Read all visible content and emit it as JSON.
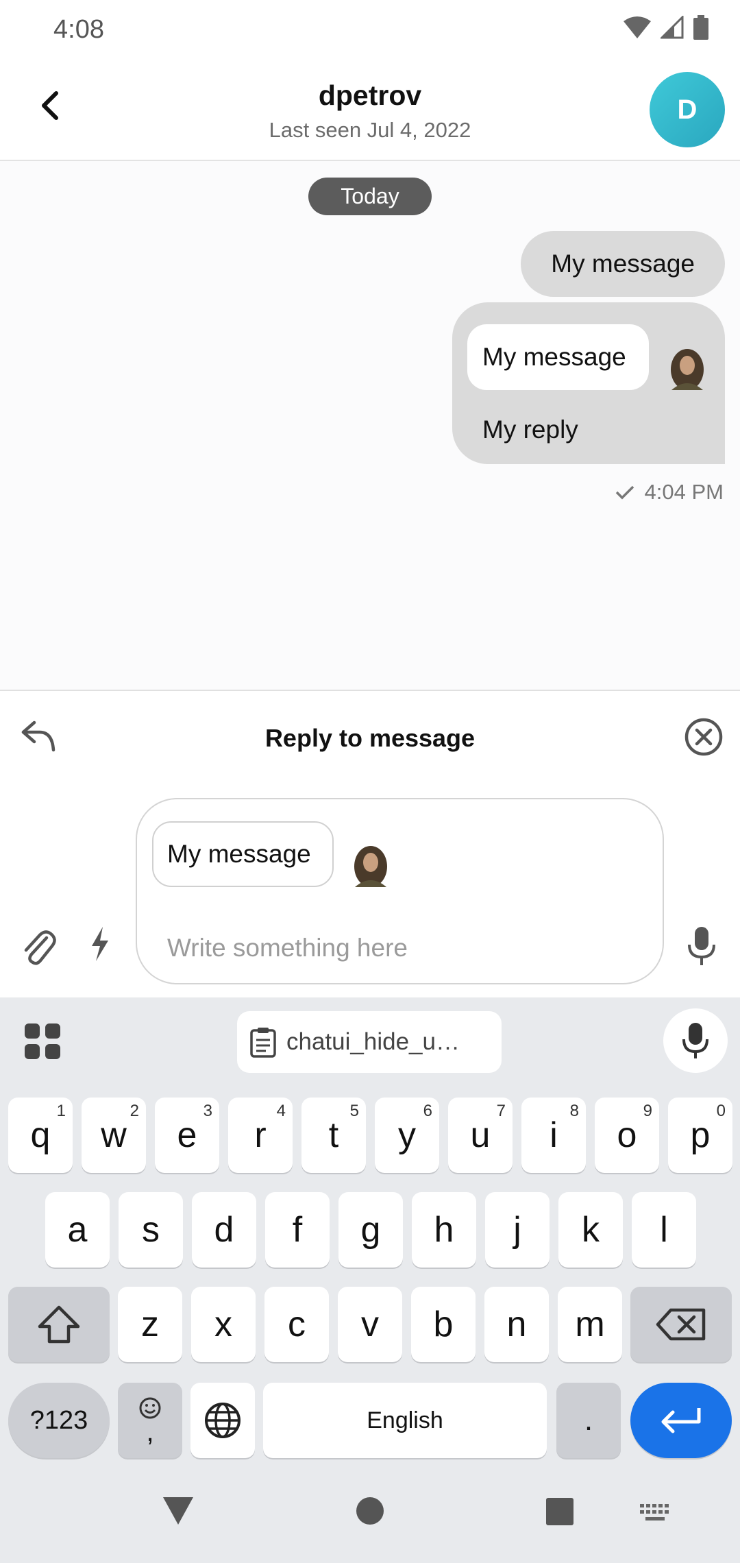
{
  "status": {
    "time": "4:08"
  },
  "header": {
    "title": "dpetrov",
    "subtitle": "Last seen Jul 4, 2022",
    "avatar_letter": "D"
  },
  "chat": {
    "date_separator": "Today",
    "messages": [
      {
        "text": "My message"
      },
      {
        "quoted_text": "My message",
        "text": "My reply",
        "time": "4:04 PM"
      }
    ]
  },
  "reply_bar": {
    "title": "Reply to message"
  },
  "composer": {
    "quoted_text": "My message",
    "placeholder": "Write something here"
  },
  "keyboard": {
    "clipboard_chip": "chatui_hide_u…",
    "row1": [
      {
        "k": "q",
        "h": "1"
      },
      {
        "k": "w",
        "h": "2"
      },
      {
        "k": "e",
        "h": "3"
      },
      {
        "k": "r",
        "h": "4"
      },
      {
        "k": "t",
        "h": "5"
      },
      {
        "k": "y",
        "h": "6"
      },
      {
        "k": "u",
        "h": "7"
      },
      {
        "k": "i",
        "h": "8"
      },
      {
        "k": "o",
        "h": "9"
      },
      {
        "k": "p",
        "h": "0"
      }
    ],
    "row2": [
      "a",
      "s",
      "d",
      "f",
      "g",
      "h",
      "j",
      "k",
      "l"
    ],
    "row3": [
      "z",
      "x",
      "c",
      "v",
      "b",
      "n",
      "m"
    ],
    "symbols_label": "?123",
    "comma_label": ",",
    "space_label": "English",
    "period_label": ".",
    "accent_color": "#1a73e8"
  }
}
